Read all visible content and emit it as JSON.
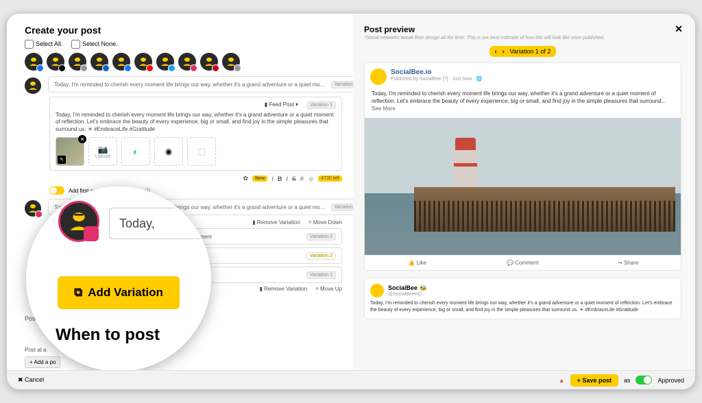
{
  "header": {
    "title": "Create your post"
  },
  "selects": {
    "all": "Select All.",
    "none": "Select None."
  },
  "post_text_short": "Today, I'm reminded to cherish every moment life brings our way, whether it's a grand adventure or a quiet moment",
  "post_text_full": "Today, I'm reminded to cherish every moment life brings our way, whether it's a grand adventure or a quiet moment of reflection. Let's embrace the beauty of every experience, big or small, and find joy in the simple pleasures that surround us. ☀ #EmbraceLife #Gratitude",
  "variation_label": "Variation 1",
  "variation2_label": "Variation 2",
  "feed_post": "Feed Post",
  "upload": "Upload",
  "toolbar": {
    "new": "New",
    "count": "4730 left"
  },
  "toggle_first_comment": "Add first comment to this post",
  "remove_variation": "Remove Variation",
  "move_down": "Move Down",
  "move_up": "Move Up",
  "text_mid": "brings our way, whether it's a grand adventure or a quiet moment",
  "text_mid2": "small, and find joy in the simple pleasures that surround us. ☀",
  "text_mid3": "our way, whether it's a grand adventure or a quiet moment",
  "magnify": {
    "pill_text": "Today,",
    "add_variation": "Add Variation",
    "when_to_post": "When to post"
  },
  "hidden": {
    "post_at": "Post at a",
    "posts": "Pos",
    "add_post": "+ Add a po"
  },
  "preview": {
    "title": "Post preview",
    "note": "*Social networks tweak their design all the time. This is our best estimate of how this will look like once published.",
    "nav": "Variation 1 of 2",
    "fb": {
      "name": "SocialBee.io",
      "meta": "Published by SocialBee [?] · Just Now · 🌐",
      "body": "Today, I'm reminded to cherish every moment life brings our way, whether it's a grand adventure or a quiet moment of reflection. Let's embrace the beauty of every experience, big or small, and find joy in the simple pleasures that surround... ",
      "more": "See More",
      "like": "Like",
      "comment": "Comment",
      "share": "Share"
    },
    "tw": {
      "name": "SocialBee 🐝",
      "handle": "@SocialBeeHQ",
      "body": "Today, I'm reminded to cherish every moment life brings our way, whether it's a grand adventure or a quiet moment of reflection. Let's embrace the beauty of every experience, big or small, and find joy in the simple pleasures that surround us. ☀ #EmbraceLife #Gratitude"
    }
  },
  "footer": {
    "cancel": "Cancel",
    "save": "+ Save post",
    "as": "as",
    "approved": "Approved"
  }
}
